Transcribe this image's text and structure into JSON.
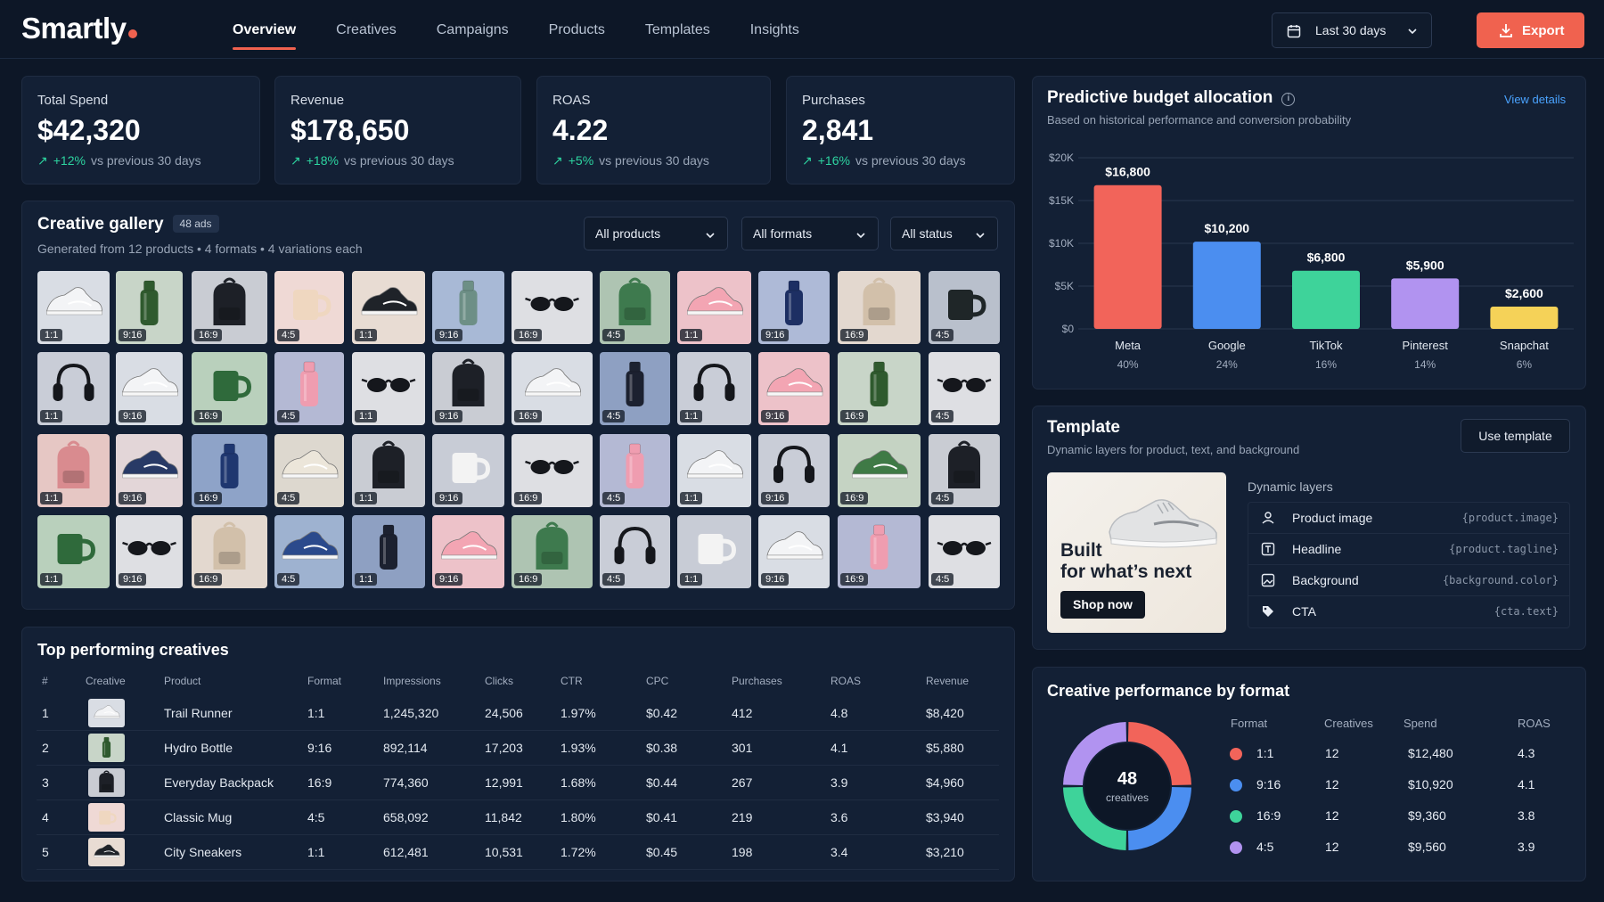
{
  "app": {
    "logo": "Smartly"
  },
  "nav": {
    "items": [
      "Overview",
      "Creatives",
      "Campaigns",
      "Products",
      "Templates",
      "Insights"
    ],
    "active": 0
  },
  "toolbar": {
    "date_range": "Last 30 days",
    "export_label": "Export"
  },
  "kpis": [
    {
      "label": "Total Spend",
      "value": "$42,320",
      "delta": "+12%",
      "compare": "vs previous 30 days"
    },
    {
      "label": "Revenue",
      "value": "$178,650",
      "delta": "+18%",
      "compare": "vs previous 30 days"
    },
    {
      "label": "ROAS",
      "value": "4.22",
      "delta": "+5%",
      "compare": "vs previous 30 days"
    },
    {
      "label": "Purchases",
      "value": "2,841",
      "delta": "+16%",
      "compare": "vs previous 30 days"
    }
  ],
  "gallery": {
    "title": "Creative gallery",
    "count_badge": "48 ads",
    "subtitle": "Generated from 12 products • 4 formats • 4 variations each",
    "filters": [
      "All products",
      "All formats",
      "All status"
    ],
    "rows": [
      [
        [
          "sneaker-white",
          "1:1"
        ],
        [
          "bottle-green",
          "9:16"
        ],
        [
          "backpack-black",
          "16:9"
        ],
        [
          "mug-cream",
          "4:5"
        ],
        [
          "sneaker-black",
          "1:1"
        ],
        [
          "bottle-green-pump",
          "9:16"
        ],
        [
          "sunglasses",
          "16:9"
        ],
        [
          "backpack-green",
          "4:5"
        ],
        [
          "sneaker-pink",
          "1:1"
        ],
        [
          "bottle-navy",
          "9:16"
        ],
        [
          "backpack-beige",
          "16:9"
        ],
        [
          "mug-dark",
          "4:5"
        ]
      ],
      [
        [
          "headphones",
          "1:1"
        ],
        [
          "sneaker-white",
          "9:16"
        ],
        [
          "mug-green",
          "16:9"
        ],
        [
          "bottle-pink",
          "4:5"
        ],
        [
          "sunglasses",
          "1:1"
        ],
        [
          "backpack-black",
          "9:16"
        ],
        [
          "sneaker-white",
          "16:9"
        ],
        [
          "bottle-black",
          "4:5"
        ],
        [
          "headphones",
          "1:1"
        ],
        [
          "sneaker-pink",
          "9:16"
        ],
        [
          "bottle-green",
          "16:9"
        ],
        [
          "sunglasses",
          "4:5"
        ]
      ],
      [
        [
          "backpack-pink",
          "1:1"
        ],
        [
          "sneaker-navy",
          "9:16"
        ],
        [
          "bottle-blue",
          "16:9"
        ],
        [
          "sneaker-cream",
          "4:5"
        ],
        [
          "backpack-black",
          "1:1"
        ],
        [
          "mug-white",
          "9:16"
        ],
        [
          "sunglasses",
          "16:9"
        ],
        [
          "bottle-pink",
          "4:5"
        ],
        [
          "sneaker-white",
          "1:1"
        ],
        [
          "headphones",
          "9:16"
        ],
        [
          "sneaker-green",
          "16:9"
        ],
        [
          "backpack-black",
          "4:5"
        ]
      ],
      [
        [
          "mug-green",
          "1:1"
        ],
        [
          "sunglasses",
          "9:16"
        ],
        [
          "backpack-beige",
          "16:9"
        ],
        [
          "sneaker-blue",
          "4:5"
        ],
        [
          "bottle-black",
          "1:1"
        ],
        [
          "sneaker-pink",
          "9:16"
        ],
        [
          "backpack-green",
          "16:9"
        ],
        [
          "headphones",
          "4:5"
        ],
        [
          "mug-white",
          "1:1"
        ],
        [
          "sneaker-white",
          "9:16"
        ],
        [
          "bottle-pink",
          "16:9"
        ],
        [
          "sunglasses",
          "4:5"
        ]
      ]
    ]
  },
  "top_creatives": {
    "title": "Top performing creatives",
    "columns": [
      "#",
      "Creative",
      "Product",
      "Format",
      "Impressions",
      "Clicks",
      "CTR",
      "CPC",
      "Purchases",
      "ROAS",
      "Revenue"
    ],
    "rows": [
      {
        "rank": "1",
        "thumb": "sneaker-white",
        "product": "Trail Runner",
        "format": "1:1",
        "impressions": "1,245,320",
        "clicks": "24,506",
        "ctr": "1.97%",
        "cpc": "$0.42",
        "purchases": "412",
        "roas": "4.8",
        "revenue": "$8,420"
      },
      {
        "rank": "2",
        "thumb": "bottle-green",
        "product": "Hydro Bottle",
        "format": "9:16",
        "impressions": "892,114",
        "clicks": "17,203",
        "ctr": "1.93%",
        "cpc": "$0.38",
        "purchases": "301",
        "roas": "4.1",
        "revenue": "$5,880"
      },
      {
        "rank": "3",
        "thumb": "backpack-black",
        "product": "Everyday Backpack",
        "format": "16:9",
        "impressions": "774,360",
        "clicks": "12,991",
        "ctr": "1.68%",
        "cpc": "$0.44",
        "purchases": "267",
        "roas": "3.9",
        "revenue": "$4,960"
      },
      {
        "rank": "4",
        "thumb": "mug-cream",
        "product": "Classic Mug",
        "format": "4:5",
        "impressions": "658,092",
        "clicks": "11,842",
        "ctr": "1.80%",
        "cpc": "$0.41",
        "purchases": "219",
        "roas": "3.6",
        "revenue": "$3,940"
      },
      {
        "rank": "5",
        "thumb": "sneaker-black",
        "product": "City Sneakers",
        "format": "1:1",
        "impressions": "612,481",
        "clicks": "10,531",
        "ctr": "1.72%",
        "cpc": "$0.45",
        "purchases": "198",
        "roas": "3.4",
        "revenue": "$3,210"
      }
    ]
  },
  "budget": {
    "title": "Predictive budget allocation",
    "subtitle": "Based on historical performance and conversion probability",
    "view_details": "View details"
  },
  "chart_data": {
    "type": "bar",
    "categories": [
      "Meta",
      "Google",
      "TikTok",
      "Pinterest",
      "Snapchat"
    ],
    "values": [
      16800,
      10200,
      6800,
      5900,
      2600
    ],
    "value_labels": [
      "$16,800",
      "$10,200",
      "$6,800",
      "$5,900",
      "$2,600"
    ],
    "shares": [
      "40%",
      "24%",
      "16%",
      "14%",
      "6%"
    ],
    "colors": [
      "#f2645a",
      "#4b8ef0",
      "#3ed39a",
      "#b193f0",
      "#f5d258"
    ],
    "yticks": [
      "$0",
      "$5K",
      "$10K",
      "$15K",
      "$20K"
    ],
    "ylim": [
      0,
      20000
    ],
    "grid": true
  },
  "template": {
    "title": "Template",
    "subtitle": "Dynamic layers for product, text, and background",
    "use_label": "Use template",
    "preview_headline": "Built\nfor what’s next",
    "preview_cta": "Shop now",
    "layers_title": "Dynamic layers",
    "layers": [
      {
        "name": "Product image",
        "token": "{product.image}",
        "icon": "product-image-icon"
      },
      {
        "name": "Headline",
        "token": "{product.tagline}",
        "icon": "headline-icon"
      },
      {
        "name": "Background",
        "token": "{background.color}",
        "icon": "background-icon"
      },
      {
        "name": "CTA",
        "token": "{cta.text}",
        "icon": "cta-tag-icon"
      }
    ]
  },
  "format_perf": {
    "title": "Creative performance by format",
    "donut_value": "48",
    "donut_label": "creatives",
    "columns": [
      "Format",
      "Creatives",
      "Spend",
      "ROAS"
    ],
    "rows": [
      {
        "format": "1:1",
        "creatives": "12",
        "spend": "$12,480",
        "roas": "4.3",
        "color": "#f2645a"
      },
      {
        "format": "9:16",
        "creatives": "12",
        "spend": "$10,920",
        "roas": "4.1",
        "color": "#4b8ef0"
      },
      {
        "format": "16:9",
        "creatives": "12",
        "spend": "$9,360",
        "roas": "3.8",
        "color": "#3ed39a"
      },
      {
        "format": "4:5",
        "creatives": "12",
        "spend": "$9,560",
        "roas": "3.9",
        "color": "#b193f0"
      }
    ],
    "donut_shares": [
      25,
      25,
      25,
      25
    ]
  }
}
